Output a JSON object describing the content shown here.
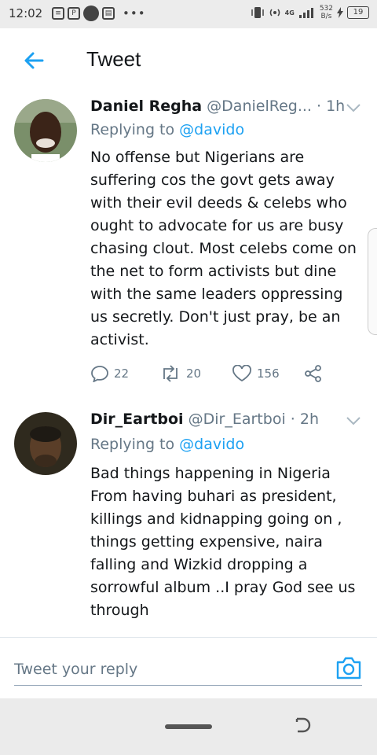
{
  "status_bar": {
    "time": "12:02",
    "network_type": "4G",
    "speed_value": "532",
    "speed_unit": "B/s",
    "battery": "19",
    "more": "•••"
  },
  "header": {
    "title": "Tweet"
  },
  "tweets": [
    {
      "name": "Daniel Regha",
      "handle": "@DanielReg...",
      "separator": "·",
      "time": "1h",
      "replying_prefix": "Replying to",
      "replying_to": "@davido",
      "text": "No offense but Nigerians are suffering cos the govt gets away with their evil deeds & celebs who ought to advocate for us are busy chasing clout. Most celebs come on the net to form activists but dine with the same leaders oppressing us secretly. Don't just pray, be an activist.",
      "replies": "22",
      "retweets": "20",
      "likes": "156"
    },
    {
      "name": "Dir_Eartboi",
      "handle": "@Dir_Eartboi",
      "separator": "·",
      "time": "2h",
      "replying_prefix": "Replying to",
      "replying_to": "@davido",
      "text": "Bad things happening in Nigeria From having buhari as president, killings and kidnapping going on , things getting expensive, naira falling and Wizkid dropping a sorrowful album ..I pray God see us through"
    }
  ],
  "reply_box": {
    "placeholder": "Tweet your reply"
  },
  "colors": {
    "accent": "#1da1f2",
    "muted": "#657786",
    "text": "#14171a"
  }
}
